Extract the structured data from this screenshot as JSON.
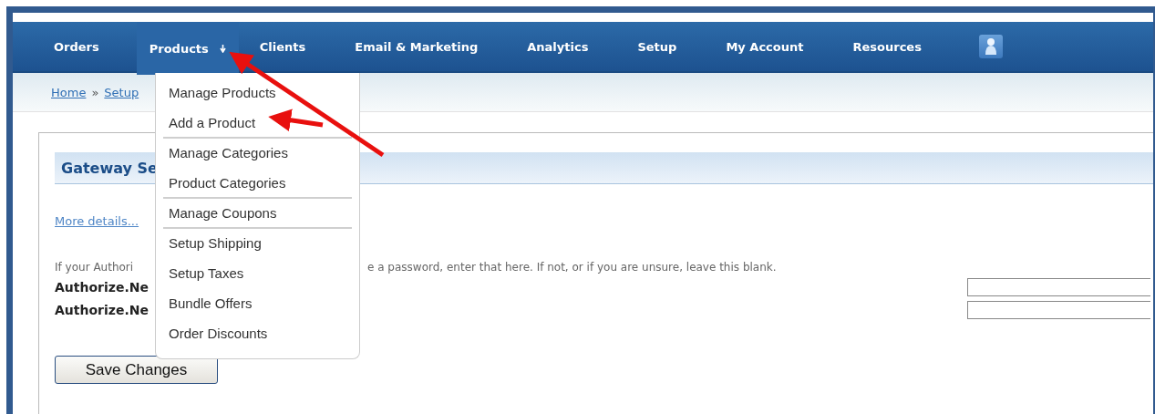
{
  "nav": {
    "items": [
      {
        "label": "Orders",
        "selected": false,
        "has_menu": false
      },
      {
        "label": "Products",
        "selected": true,
        "has_menu": true
      },
      {
        "label": "Clients",
        "selected": false,
        "has_menu": false
      },
      {
        "label": "Email & Marketing",
        "selected": false,
        "has_menu": false
      },
      {
        "label": "Analytics",
        "selected": false,
        "has_menu": false
      },
      {
        "label": "Setup",
        "selected": false,
        "has_menu": false
      },
      {
        "label": "My Account",
        "selected": false,
        "has_menu": false
      },
      {
        "label": "Resources",
        "selected": false,
        "has_menu": false
      }
    ]
  },
  "breadcrumb": [
    {
      "kind": "link",
      "text": "Home"
    },
    {
      "kind": "sep",
      "text": "»"
    },
    {
      "kind": "link",
      "text": "Setup"
    }
  ],
  "dropdown": {
    "items": [
      {
        "label": "Manage Products",
        "separator_after": false
      },
      {
        "label": "Add a Product",
        "separator_after": true
      },
      {
        "label": "Manage Categories",
        "separator_after": false
      },
      {
        "label": "Product Categories",
        "separator_after": true
      },
      {
        "label": "Manage Coupons",
        "separator_after": true
      },
      {
        "label": "Setup Shipping",
        "separator_after": false
      },
      {
        "label": "Setup Taxes",
        "separator_after": false
      },
      {
        "label": "Bundle Offers",
        "separator_after": false
      },
      {
        "label": "Order Discounts",
        "separator_after": false
      }
    ]
  },
  "section": {
    "title": "Gateway Se",
    "link": "More details...",
    "help": [
      "If your Authori",
      "e a password, enter that here. If not, or if you are unsure, leave this blank."
    ],
    "fields": [
      {
        "label": "Authorize.Ne"
      },
      {
        "label": "Authorize.Ne"
      }
    ],
    "button": "Save Changes"
  }
}
